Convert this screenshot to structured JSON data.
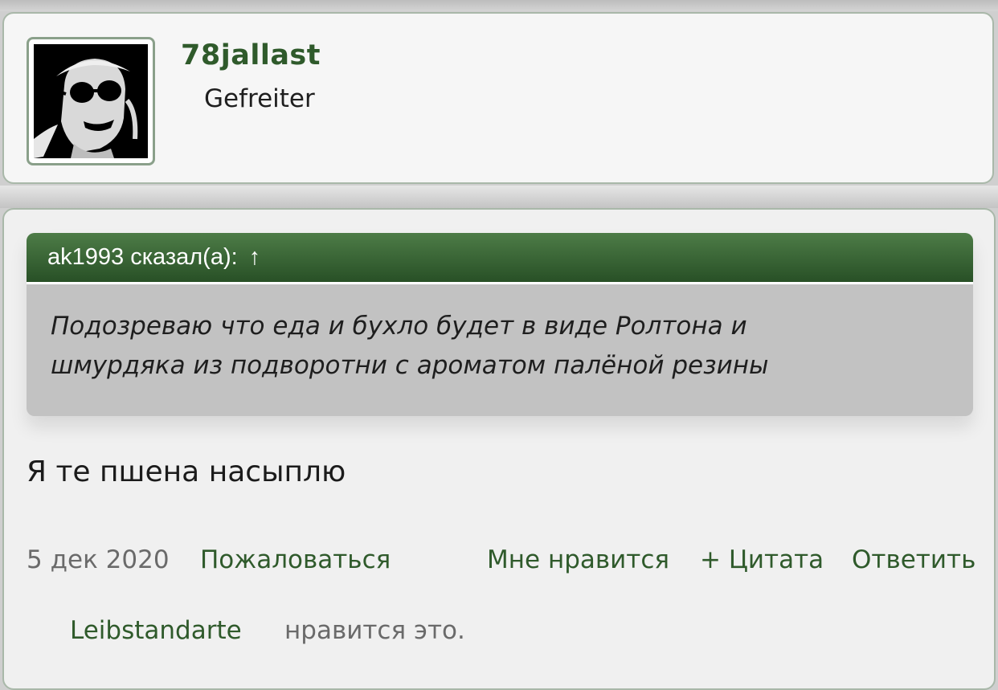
{
  "user": {
    "name": "78jallast",
    "title": "Gefreiter"
  },
  "quote": {
    "author": "ak1993 сказал(а):",
    "arrow": "↑",
    "text_line1": "Подозреваю что еда и бухло будет в виде Ролтона и",
    "text_line2": "шмурдяка из подворотни с ароматом палёной резины"
  },
  "post": {
    "message": "Я те пшена насыплю",
    "date": "5 дек 2020",
    "report_label": "Пожаловаться",
    "like_label": "Мне нравится",
    "quote_label": "+ Цитата",
    "reply_label": "Ответить"
  },
  "likes": {
    "user": "Leibstandarte",
    "text": "нравится это."
  },
  "colors": {
    "accent_green": "#2f5a2b",
    "quote_header_top": "#4d7c47",
    "quote_header_bottom": "#285026",
    "quote_bg": "#c2c2c2"
  }
}
